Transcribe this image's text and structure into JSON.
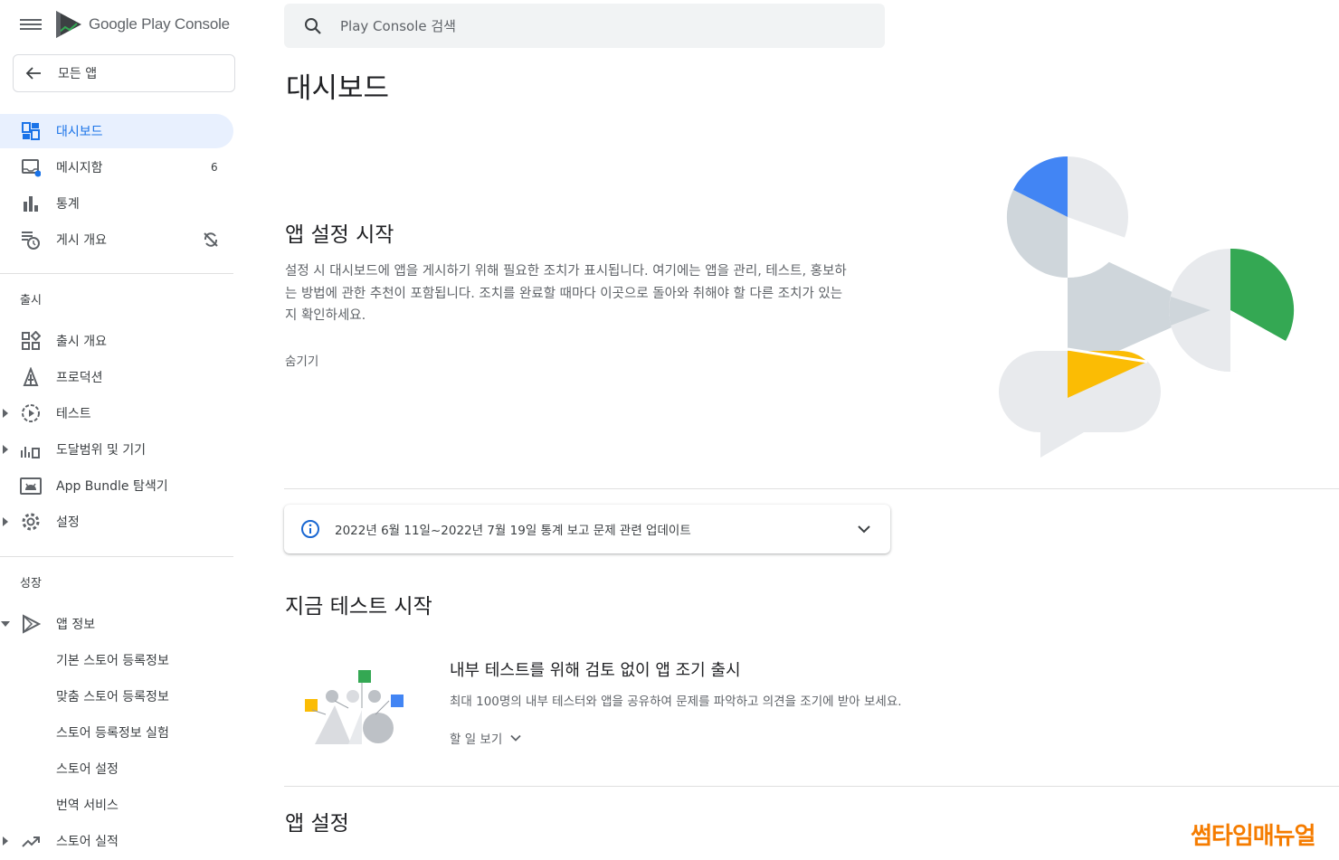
{
  "header": {
    "logo_text": "Google Play Console",
    "search_placeholder": "Play Console 검색"
  },
  "sidebar": {
    "all_apps": "모든 앱",
    "items": [
      {
        "label": "대시보드",
        "icon": "dashboard-icon",
        "active": true
      },
      {
        "label": "메시지함",
        "icon": "inbox-icon",
        "badge": "6"
      },
      {
        "label": "통계",
        "icon": "bar-chart-icon"
      },
      {
        "label": "게시 개요",
        "icon": "publishing-icon"
      }
    ],
    "release_header": "출시",
    "release_items": [
      {
        "label": "출시 개요",
        "icon": "release-overview-icon"
      },
      {
        "label": "프로덕션",
        "icon": "production-icon"
      },
      {
        "label": "테스트",
        "icon": "testing-icon"
      },
      {
        "label": "도달범위 및 기기",
        "icon": "reach-devices-icon"
      },
      {
        "label": "App Bundle 탐색기",
        "icon": "android-icon"
      },
      {
        "label": "설정",
        "icon": "settings-icon"
      }
    ],
    "grow_header": "성장",
    "grow_items": [
      {
        "label": "앱 정보",
        "icon": "play-icon"
      },
      {
        "label": "기본 스토어 등록정보"
      },
      {
        "label": "맞춤 스토어 등록정보"
      },
      {
        "label": "스토어 등록정보 실험"
      },
      {
        "label": "스토어 설정"
      },
      {
        "label": "번역 서비스"
      },
      {
        "label": "스토어 실적",
        "icon": "trending-icon"
      }
    ]
  },
  "main": {
    "title": "대시보드",
    "setup": {
      "title": "앱 설정 시작",
      "description": "설정 시 대시보드에 앱을 게시하기 위해 필요한 조치가 표시됩니다. 여기에는 앱을 관리, 테스트, 홍보하는 방법에 관한 추천이 포함됩니다. 조치를 완료할 때마다 이곳으로 돌아와 취해야 할 다른 조치가 있는지 확인하세요.",
      "hide": "숨기기"
    },
    "notice": "2022년 6월 11일~2022년 7월 19일 통계 보고 문제 관련 업데이트",
    "test": {
      "title": "지금 테스트 시작",
      "heading": "내부 테스트를 위해 검토 없이 앱 조기 출시",
      "description": "최대 100명의 내부 테스터와 앱을 공유하여 문제를 파악하고 의견을 조기에 받아 보세요.",
      "todo": "할 일 보기"
    },
    "app_settings_title": "앱 설정"
  },
  "watermark": "썸타임매뉴얼",
  "colors": {
    "accent_blue": "#1a73e8",
    "active_bg": "#e8f0fe",
    "green": "#34a853",
    "yellow": "#fbbc04",
    "blue": "#4285f4",
    "watermark": "#f57c00"
  }
}
